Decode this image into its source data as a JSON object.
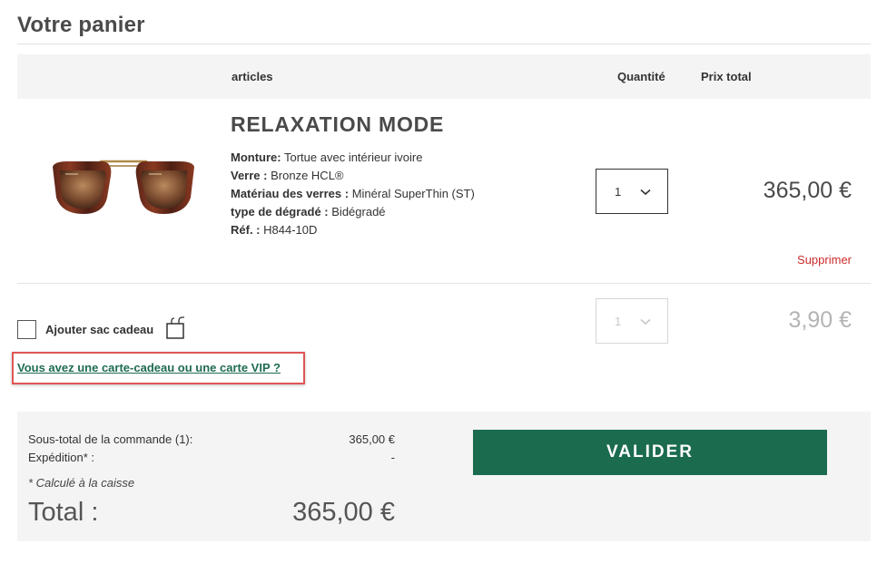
{
  "page": {
    "title": "Votre panier"
  },
  "table_header": {
    "articles": "articles",
    "quantity": "Quantité",
    "total_price": "Prix total"
  },
  "item": {
    "name": "RELAXATION MODE",
    "attributes": [
      {
        "label": "Monture:",
        "value": "Tortue avec intérieur ivoire"
      },
      {
        "label": "Verre :",
        "value": "Bronze HCL®"
      },
      {
        "label": "Matériau des verres :",
        "value": "Minéral SuperThin (ST)"
      },
      {
        "label": "type de dégradé :",
        "value": "Bidégradé"
      },
      {
        "label": "Réf. :",
        "value": "H844-10D"
      }
    ],
    "quantity": "1",
    "price": "365,00 €",
    "delete_label": "Supprimer",
    "image_icon": "sunglasses-image"
  },
  "gift_bag": {
    "label": "Ajouter sac cadeau",
    "quantity": "1",
    "price": "3,90 €",
    "icon": "gift-bag-icon"
  },
  "gift_card_link": "Vous avez une carte-cadeau ou une carte VIP ?",
  "summary": {
    "subtotal_label": "Sous-total de la commande (1):",
    "subtotal_value": "365,00 €",
    "shipping_label": "Expédition* :",
    "shipping_value": "-",
    "note": "* Calculé à la caisse",
    "total_label": "Total :",
    "total_value": "365,00 €"
  },
  "validate_button": "VALIDER",
  "colors": {
    "accent": "#1b6b4f",
    "link": "#1e6b52",
    "delete": "#cc2b2b",
    "highlight_border": "#e05656"
  }
}
